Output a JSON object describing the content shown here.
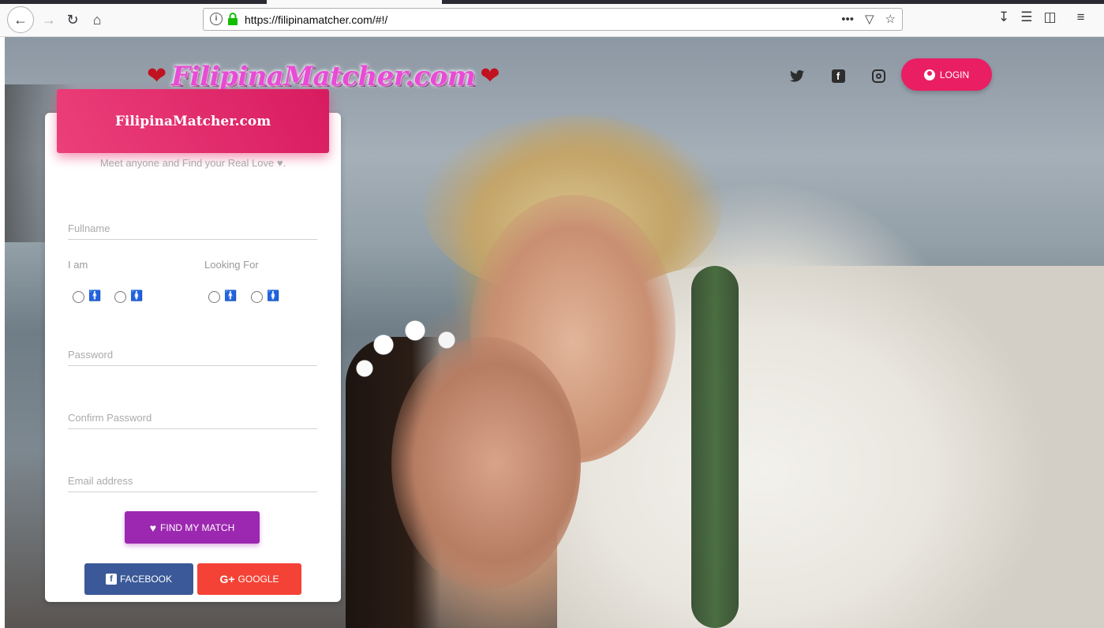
{
  "browser": {
    "url": "https://filipinamatcher.com/#!/"
  },
  "header": {
    "logo_text": "FilipinaMatcher.com",
    "login_label": "LOGIN"
  },
  "card": {
    "title": "FilipinaMatcher.com",
    "subtitle": "Meet anyone and Find your Real Love ♥.",
    "fields": {
      "fullname": "Fullname",
      "password": "Password",
      "confirm_password": "Confirm Password",
      "email": "Email address"
    },
    "i_am_label": "I am",
    "looking_for_label": "Looking For",
    "find_match_label": "FIND MY MATCH",
    "facebook_label": "FACEBOOK",
    "google_label": "GOOGLE"
  },
  "icons": {
    "back": "back-arrow-icon",
    "forward": "forward-arrow-icon",
    "reload": "reload-icon",
    "home": "home-icon",
    "twitter": "twitter-icon",
    "facebook": "facebook-icon",
    "instagram": "instagram-icon",
    "user": "user-circle-icon",
    "heart": "heart-icon",
    "male": "male-icon",
    "female": "female-icon"
  },
  "colors": {
    "accent_pink": "#e91e63",
    "find_purple": "#9c27b0",
    "facebook_blue": "#3b5998",
    "google_red": "#f44336"
  }
}
